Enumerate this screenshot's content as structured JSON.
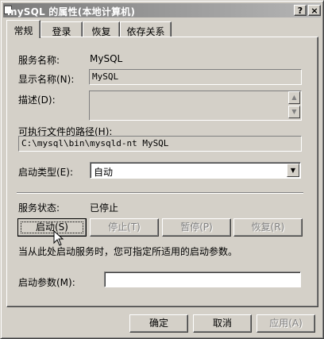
{
  "window": {
    "title": "mySQL 的属性(本地计算机)",
    "help_label": "?",
    "close_label": "×"
  },
  "tabs": [
    {
      "label": "常规"
    },
    {
      "label": "登录"
    },
    {
      "label": "恢复"
    },
    {
      "label": "依存关系"
    }
  ],
  "general": {
    "service_name_label": "服务名称:",
    "service_name_value": "MySQL",
    "display_name_label": "显示名称(N):",
    "display_name_value": "MySQL",
    "description_label": "描述(D):",
    "description_value": "",
    "exe_path_label": "可执行文件的路径(H):",
    "exe_path_value": "C:\\mysql\\bin\\mysqld-nt MySQL",
    "startup_type_label": "启动类型(E):",
    "startup_type_value": "自动",
    "service_status_label": "服务状态:",
    "service_status_value": "已停止",
    "start_button": "启动(S)",
    "stop_button": "停止(T)",
    "pause_button": "暂停(P)",
    "resume_button": "恢复(R)",
    "hint_text": "当从此处启动服务时，您可指定所适用的启动参数。",
    "start_params_label": "启动参数(M):",
    "start_params_value": ""
  },
  "footer": {
    "ok_button": "确定",
    "cancel_button": "取消",
    "apply_button": "应用(A)"
  },
  "icons": {
    "scroll_up": "scroll-up-arrow-icon",
    "scroll_down": "scroll-down-arrow-icon",
    "dropdown": "dropdown-arrow-icon",
    "cursor": "mouse-pointer-icon"
  }
}
